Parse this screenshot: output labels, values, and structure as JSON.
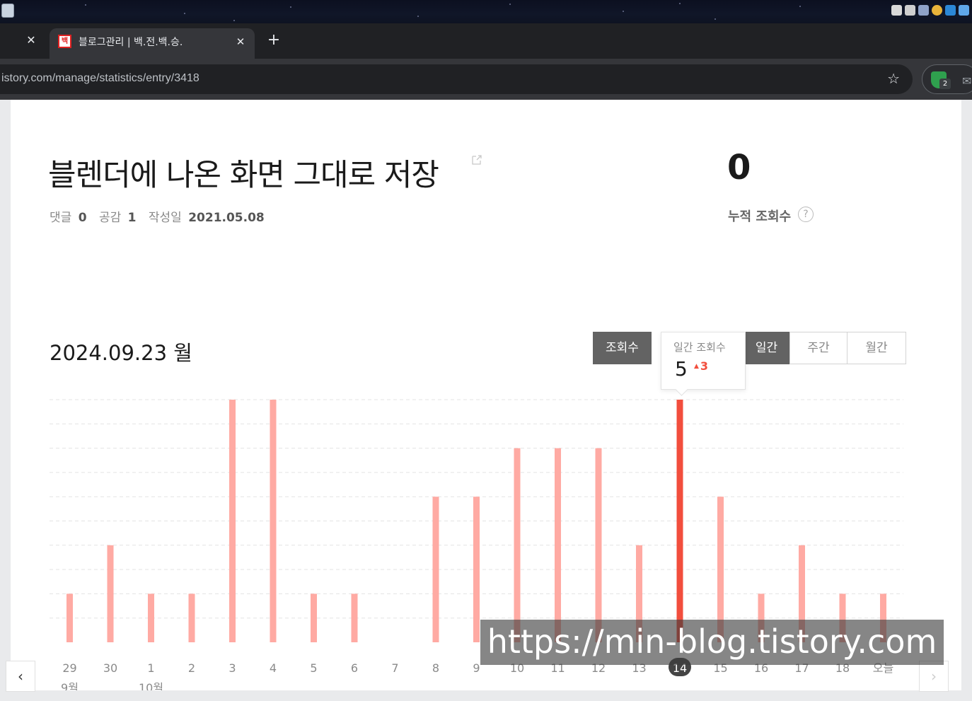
{
  "browser": {
    "tab_title": "블로그관리 | 백.전.백.승.",
    "tab_favicon_text": "백",
    "url": "istory.com/manage/statistics/entry/3418",
    "extension_badge": "2"
  },
  "post": {
    "title": "블렌더에 나온 화면 그대로 저장",
    "comments_label": "댓글",
    "comments_value": "0",
    "likes_label": "공감",
    "likes_value": "1",
    "date_label": "작성일",
    "date_value": "2021.05.08",
    "total_views_value": "0",
    "total_views_label": "누적 조회수",
    "help_icon": "?"
  },
  "stats": {
    "selected_date": "2024.09.23 월",
    "metric_button": "조회수",
    "period_buttons": [
      "일간",
      "주간",
      "월간"
    ],
    "active_period": "일간",
    "tooltip_label": "일간 조회수",
    "tooltip_value": "5",
    "tooltip_delta": "3"
  },
  "watermark": "https://min-blog.tistory.com",
  "colors": {
    "bar": "#ffaaa3",
    "bar_selected": "#f24e3d",
    "active_button": "#636363",
    "delta_up": "#f24e3d"
  },
  "chart_data": {
    "type": "bar",
    "categories": [
      "29",
      "30",
      "1",
      "2",
      "3",
      "4",
      "5",
      "6",
      "7",
      "8",
      "9",
      "10",
      "11",
      "12",
      "13",
      "14",
      "15",
      "16",
      "17",
      "18",
      "오늘"
    ],
    "month_labels": [
      "9월",
      "10월"
    ],
    "month_label_positions": [
      "29",
      "1"
    ],
    "values": [
      1,
      2,
      1,
      1,
      5,
      5,
      1,
      1,
      0,
      3,
      3,
      4,
      4,
      4,
      2,
      5,
      3,
      1,
      2,
      1,
      1
    ],
    "selected": "14",
    "ylim": [
      0,
      5
    ],
    "grid": true,
    "title": "",
    "xlabel": "",
    "ylabel": ""
  }
}
